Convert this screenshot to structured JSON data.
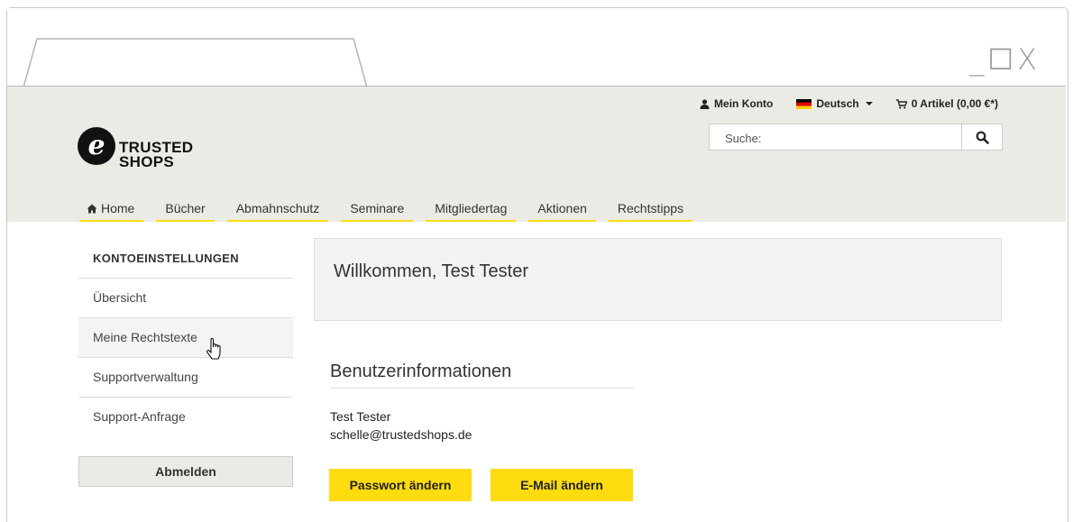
{
  "window": {
    "controls": "_☐X"
  },
  "topnav": {
    "account": "Mein Konto",
    "language": "Deutsch",
    "cart": "0 Artikel (0,00 €*)"
  },
  "search": {
    "placeholder": "Suche:"
  },
  "logo": {
    "line1": "TRUSTED",
    "line2": "SHOPS",
    "mark": "e"
  },
  "mainnav": {
    "items": [
      "Home",
      "Bücher",
      "Abmahnschutz",
      "Seminare",
      "Mitgliedertag",
      "Aktionen",
      "Rechtstipps"
    ]
  },
  "sidebar": {
    "title": "KONTOEINSTELLUNGEN",
    "items": [
      "Übersicht",
      "Meine Rechtstexte",
      "Supportverwaltung",
      "Support-Anfrage"
    ],
    "logout": "Abmelden"
  },
  "main": {
    "welcome": "Willkommen, Test Tester",
    "section_title": "Benutzerinformationen",
    "user_name": "Test Tester",
    "user_email": "schelle@trustedshops.de",
    "btn_password": "Passwort ändern",
    "btn_email": "E-Mail ändern"
  },
  "colors": {
    "accent": "#ffdc0f",
    "header_bg": "#ebebe6"
  }
}
